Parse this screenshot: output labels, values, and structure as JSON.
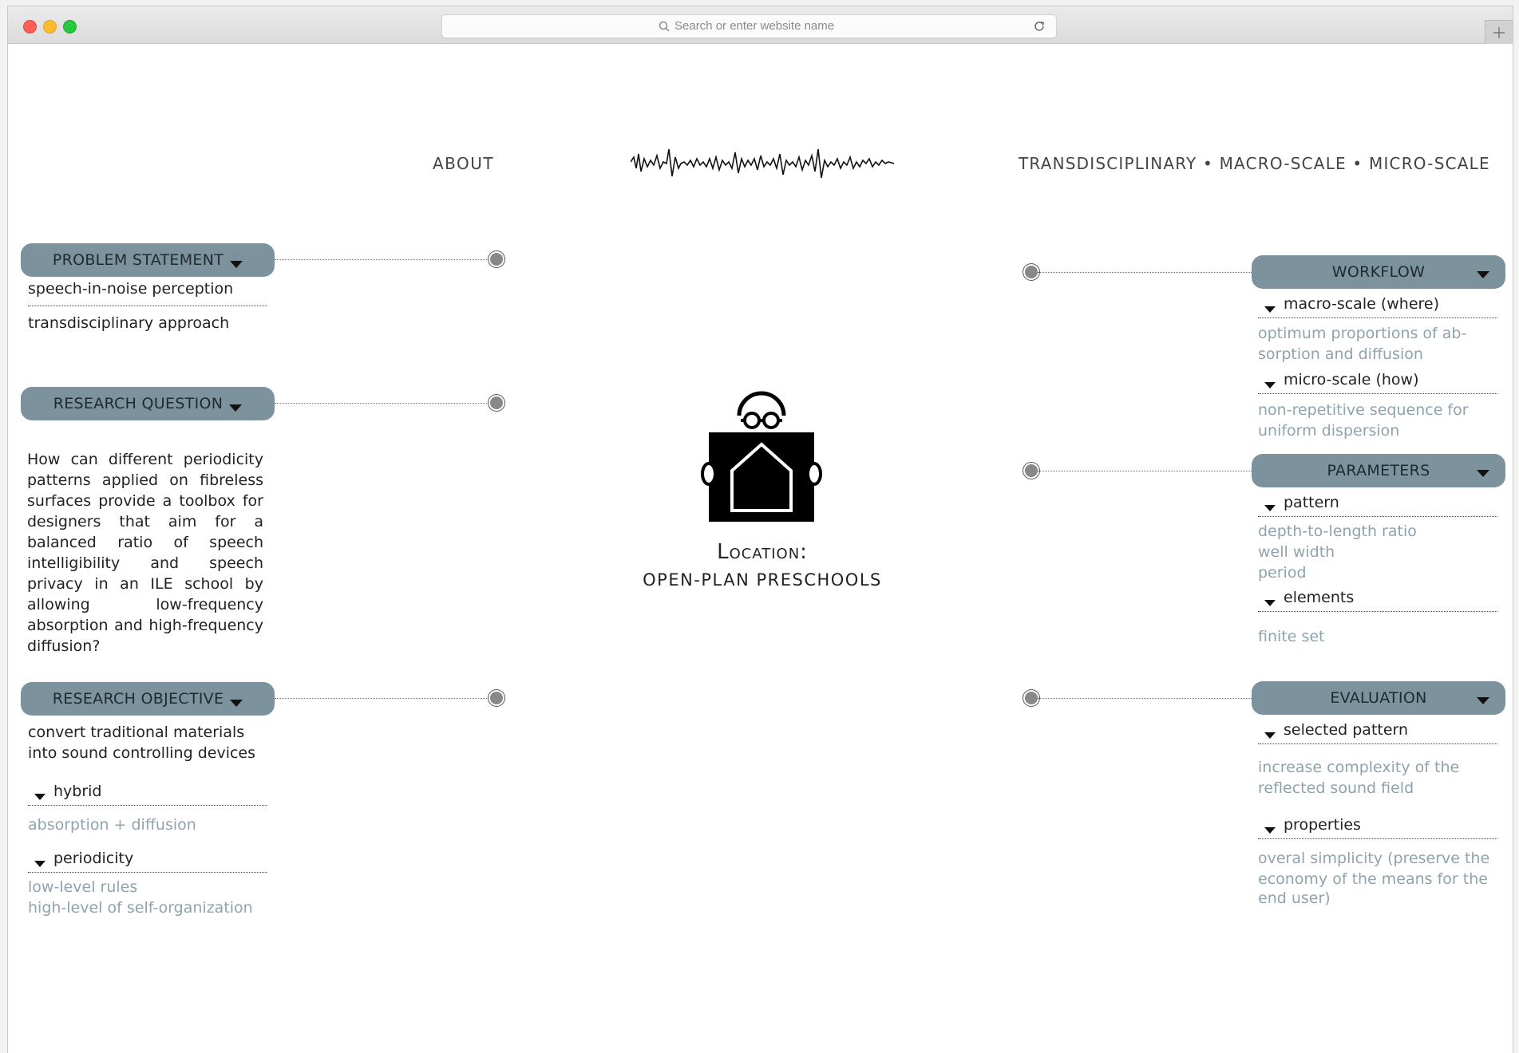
{
  "browser": {
    "address_placeholder": "Search or enter website name"
  },
  "nav": {
    "about": "ABOUT",
    "right_links": "TRANSDISCIPLINARY • MACRO-SCALE • MICRO-SCALE"
  },
  "left": {
    "problem_statement": {
      "title": "PROBLEM STATEMENT",
      "items": [
        "speech-in-noise perception",
        "transdisciplinary approach"
      ]
    },
    "research_question": {
      "title": "RESEARCH QUESTION",
      "text": "How can different periodicity patterns applied on fibreless surfaces provide a toolbox for designers that aim for a balanced ratio of speech intelligibility and speech privacy in an ILE school by allowing low-frequency absorption and high-frequency diffusion?"
    },
    "research_objective": {
      "title": "RESEARCH OBJECTIVE",
      "lead_line1": "convert traditional materials",
      "lead_line2": "into sound controlling devices",
      "hybrid": "hybrid",
      "hybrid_detail": "absorption + diffusion",
      "periodicity": "periodicity",
      "periodicity_detail1": "low-level rules",
      "periodicity_detail2": "high-level of self-organization"
    }
  },
  "center": {
    "location_label": "Location:",
    "location_value": "OPEN-PLAN PRESCHOOLS"
  },
  "right": {
    "workflow": {
      "title": "WORKFLOW",
      "macro": "macro-scale (where)",
      "macro_detail1": "optimum proportions of ab-",
      "macro_detail2": "sorption and diffusion",
      "micro": "micro-scale (how)",
      "micro_detail1": "non-repetitive sequence for",
      "micro_detail2": "uniform dispersion"
    },
    "parameters": {
      "title": "PARAMETERS",
      "pattern": "pattern",
      "pattern_detail1": "depth-to-length ratio",
      "pattern_detail2": "well width",
      "pattern_detail3": "period",
      "elements": "elements",
      "elements_detail": "finite set"
    },
    "evaluation": {
      "title": "EVALUATION",
      "selected": "selected pattern",
      "selected_detail1": "increase complexity of the",
      "selected_detail2": "reflected sound field",
      "properties": "properties",
      "properties_detail1": "overal simplicity (preserve the",
      "properties_detail2": "economy of the means for the",
      "properties_detail3": "end user)"
    }
  },
  "colors": {
    "panel": "#7c929d",
    "muted_text": "#8fa3ad"
  },
  "icons": [
    "search-icon",
    "reload-icon",
    "plus-icon",
    "waveform-logo",
    "caret-down-icon",
    "child-holding-house-icon"
  ]
}
